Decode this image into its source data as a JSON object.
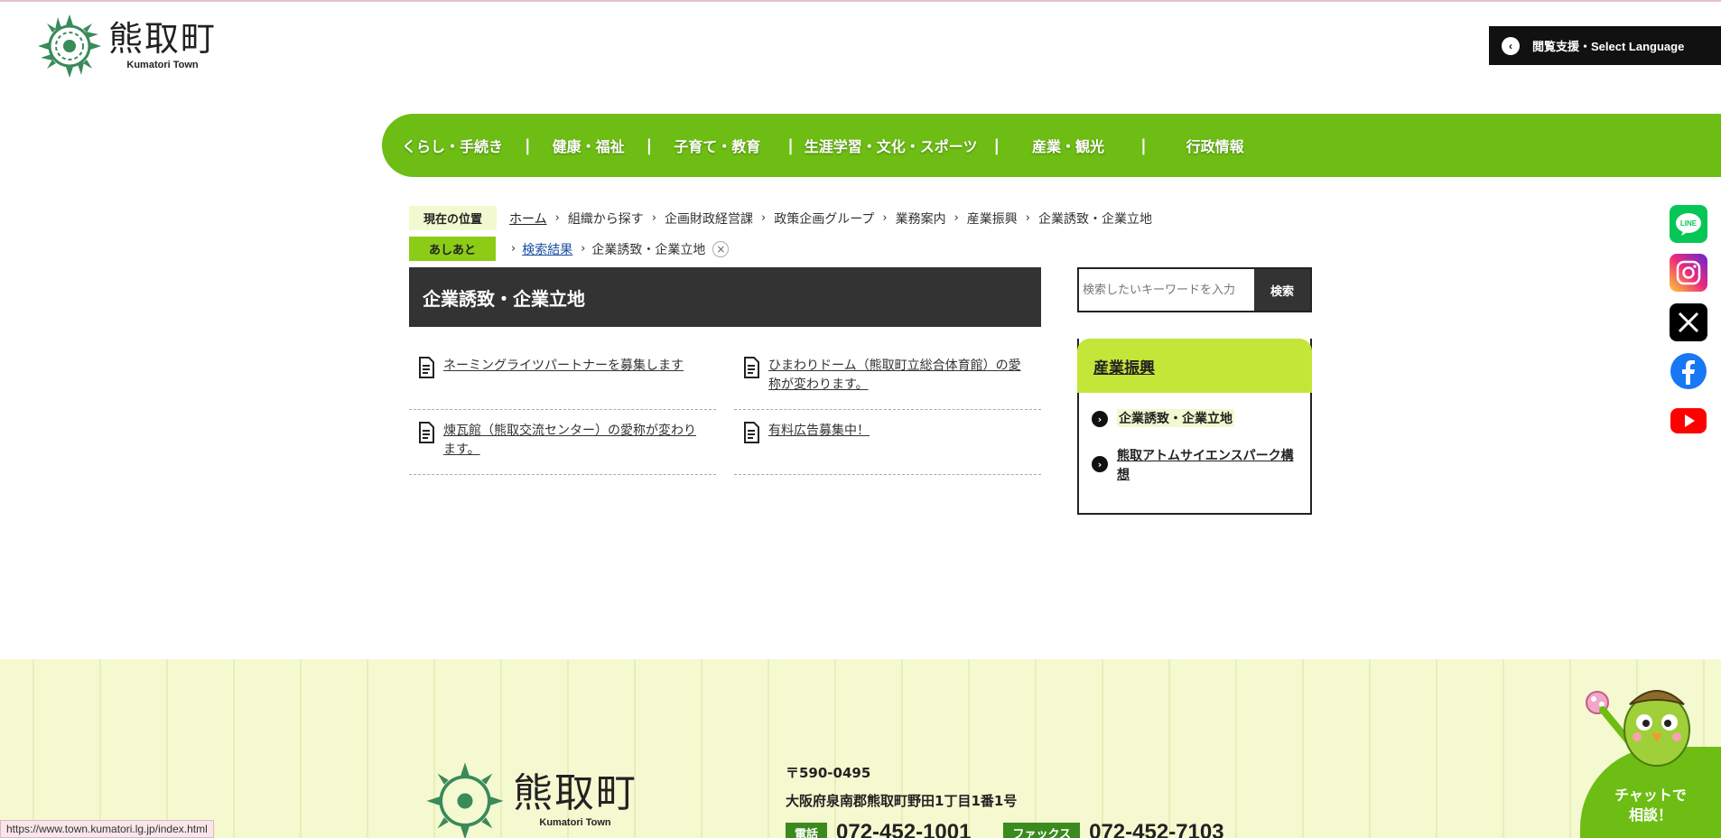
{
  "header": {
    "logo_jp": "熊取町",
    "logo_en": "Kumatori Town",
    "language_button": "閲覧支援・Select Language"
  },
  "gnav": {
    "items": [
      {
        "label": "くらし・手続き"
      },
      {
        "label": "健康・福祉"
      },
      {
        "label": "子育て・教育"
      },
      {
        "label": "生涯学習・文化・スポーツ"
      },
      {
        "label": "産業・観光"
      },
      {
        "label": "行政情報"
      }
    ],
    "separator": "|"
  },
  "breadcrumb": {
    "current_label": "現在の位置",
    "items": [
      "ホーム",
      "組織から探す",
      "企画財政経営課",
      "政策企画グループ",
      "業務案内",
      "産業振興",
      "企業誘致・企業立地"
    ]
  },
  "history": {
    "label": "あしあと",
    "items": [
      "検索結果",
      "企業誘致・企業立地"
    ],
    "close": "×"
  },
  "page": {
    "title": "企業誘致・企業立地"
  },
  "articles": [
    {
      "title": "ネーミングライツパートナーを募集します"
    },
    {
      "title": "ひまわりドーム（熊取町立総合体育館）の愛称が変わります。"
    },
    {
      "title": "煉瓦館（熊取交流センター）の愛称が変わります。"
    },
    {
      "title": "有料広告募集中！"
    }
  ],
  "search": {
    "placeholder": "検索したいキーワードを入力",
    "button": "検索"
  },
  "side_menu": {
    "title": "産業振興",
    "items": [
      {
        "label": "企業誘致・企業立地",
        "current": true
      },
      {
        "label": "熊取アトムサイエンスパーク構想",
        "current": false
      }
    ]
  },
  "sns": [
    {
      "name": "LINE",
      "icon": "line-icon",
      "color": "#06c755"
    },
    {
      "name": "Instagram",
      "icon": "instagram-icon",
      "color": "#d6249f"
    },
    {
      "name": "X",
      "icon": "x-icon",
      "color": "#000000"
    },
    {
      "name": "Facebook",
      "icon": "facebook-icon",
      "color": "#1877f2"
    },
    {
      "name": "YouTube",
      "icon": "youtube-icon",
      "color": "#ff0000"
    }
  ],
  "footer": {
    "logo_jp": "熊取町",
    "logo_en": "Kumatori Town",
    "postal": "〒590-0495",
    "address": "大阪府泉南郡熊取町野田1丁目1番1号",
    "tel_label": "電話",
    "tel": "072-452-1001",
    "fax_label": "ファックス",
    "fax": "072-452-7103",
    "chat_line1": "チャットで",
    "chat_line2": "相談！"
  },
  "status_url": "https://www.town.kumatori.lg.jp/index.html",
  "colors": {
    "accent_green": "#6dbd14",
    "dark": "#333333",
    "footer_bg": "#f5f9d0"
  }
}
